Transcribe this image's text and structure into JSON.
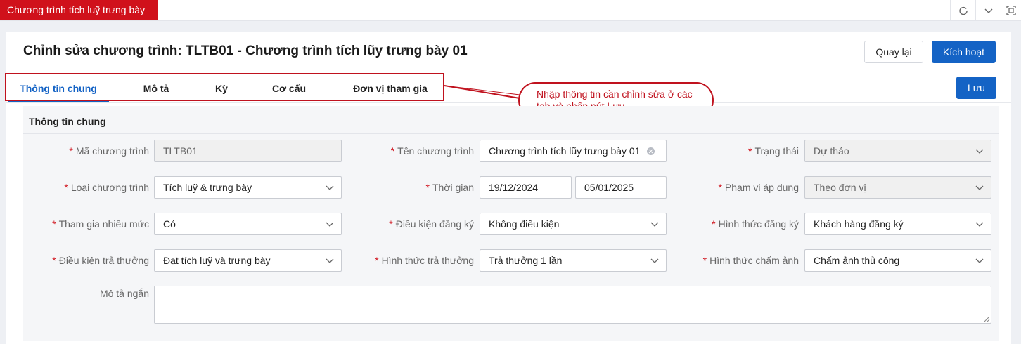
{
  "window": {
    "app_tab": "Chương trình tích luỹ trưng bày",
    "icons": [
      "refresh-icon",
      "chevron-down-icon",
      "maximize-icon"
    ]
  },
  "page": {
    "title": "Chỉnh sửa chương trình: TLTB01 - Chương trình tích lũy trưng bày 01",
    "back_label": "Quay lại",
    "activate_label": "Kích hoạt",
    "save_label": "Lưu"
  },
  "tabs": [
    {
      "label": "Thông tin chung",
      "active": true
    },
    {
      "label": "Mô tả",
      "active": false
    },
    {
      "label": "Kỳ",
      "active": false
    },
    {
      "label": "Cơ cấu",
      "active": false
    },
    {
      "label": "Đơn vị tham gia",
      "active": false
    }
  ],
  "callout": {
    "text": "Nhập thông tin cần chỉnh sửa ở các tab và nhấn nút Lưu",
    "color": "#c0121e"
  },
  "section": {
    "title": "Thông tin chung",
    "required_mark": "*",
    "fields": {
      "ma_ct": {
        "label": "Mã chương trình",
        "value": "TLTB01"
      },
      "ten_ct": {
        "label": "Tên chương trình",
        "value": "Chương trình tích lũy trưng bày 01"
      },
      "trang_thai": {
        "label": "Trạng thái",
        "value": "Dự thảo"
      },
      "loai_ct": {
        "label": "Loại chương trình",
        "value": "Tích luỹ & trưng bày"
      },
      "thoi_gian": {
        "label": "Thời gian",
        "from": "19/12/2024",
        "to": "05/01/2025"
      },
      "pham_vi": {
        "label": "Phạm vi áp dụng",
        "value": "Theo đơn vị"
      },
      "tham_gia": {
        "label": "Tham gia nhiều mức",
        "value": "Có"
      },
      "dieu_kien_dk": {
        "label": "Điều kiện đăng ký",
        "value": "Không điều kiện"
      },
      "hinh_thuc_dk": {
        "label": "Hình thức đăng ký",
        "value": "Khách hàng đăng ký"
      },
      "dieu_kien_tt": {
        "label": "Điều kiện trả thưởng",
        "value": "Đạt tích luỹ và trưng bày"
      },
      "hinh_thuc_tt": {
        "label": "Hình thức trả thưởng",
        "value": "Trả thưởng 1 lần"
      },
      "hinh_thuc_ca": {
        "label": "Hình thức chấm ảnh",
        "value": "Chấm ảnh thủ công"
      },
      "mo_ta_ngan": {
        "label": "Mô tả ngắn",
        "value": ""
      }
    }
  },
  "colors": {
    "brand_red": "#d0111b",
    "primary_blue": "#1463c5"
  }
}
